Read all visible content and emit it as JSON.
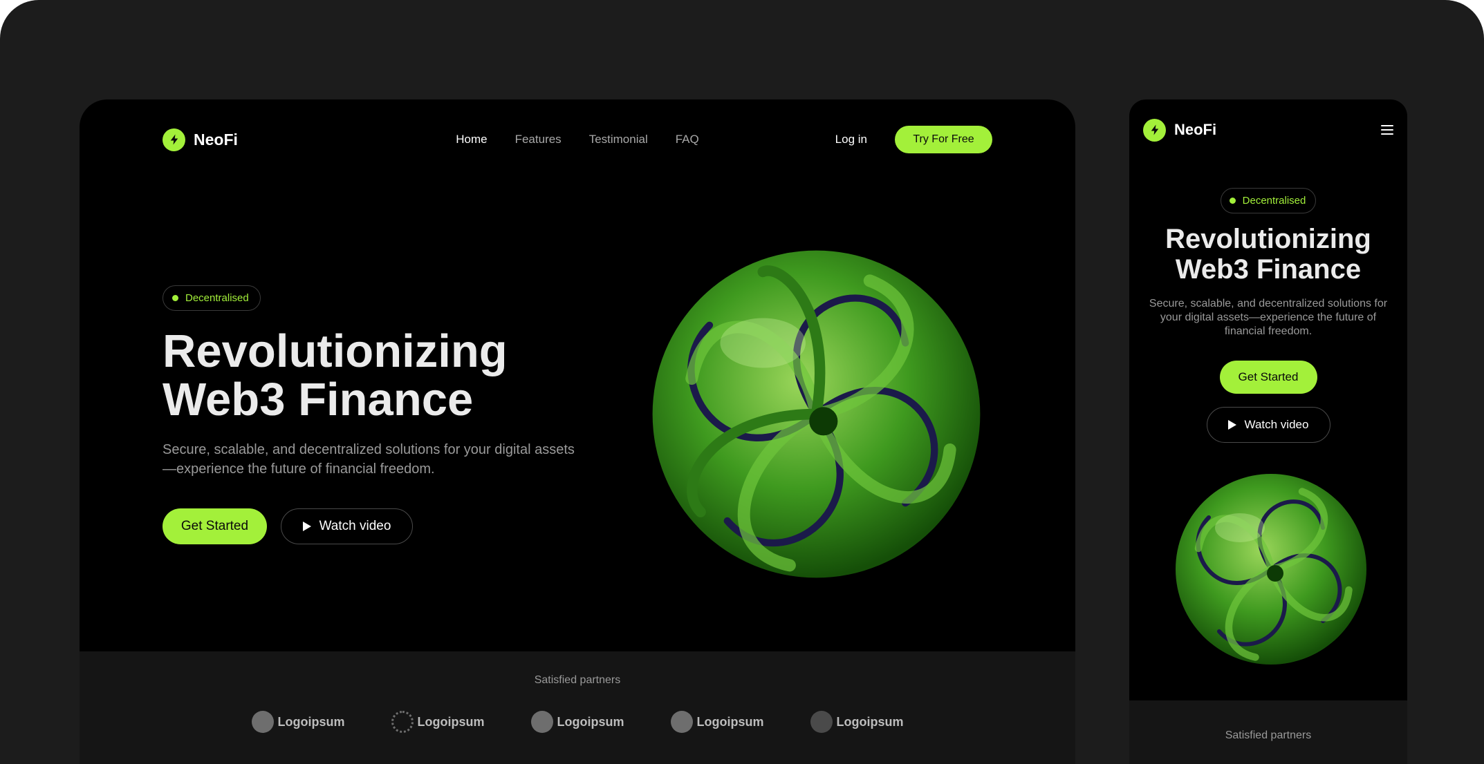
{
  "brand": {
    "name": "NeoFi",
    "accent": "#a3f03a"
  },
  "nav": {
    "links": [
      "Home",
      "Features",
      "Testimonial",
      "FAQ"
    ],
    "login": "Log in",
    "cta": "Try For Free"
  },
  "hero": {
    "badge": "Decentralised",
    "title_line1": "Revolutionizing",
    "title_line2": "Web3 Finance",
    "subtitle": "Secure, scalable, and decentralized solutions for your digital assets—experience the future of financial freedom.",
    "primary_cta": "Get Started",
    "secondary_cta": "Watch video"
  },
  "partners": {
    "label": "Satisfied partners",
    "logos": [
      "Logoipsum",
      "Logoipsum",
      "Logoipsum",
      "Logoipsum",
      "Logoipsum"
    ]
  },
  "mobile": {
    "badge": "Decentralised",
    "title_line1": "Revolutionizing",
    "title_line2": "Web3 Finance",
    "subtitle": "Secure, scalable, and decentralized solutions for your digital assets—experience the future of financial freedom.",
    "primary_cta": "Get Started",
    "secondary_cta": "Watch video",
    "partners_label": "Satisfied partners"
  },
  "icons": {
    "logo": "lightning-bolt-icon",
    "menu": "hamburger-menu-icon",
    "play": "play-icon"
  }
}
